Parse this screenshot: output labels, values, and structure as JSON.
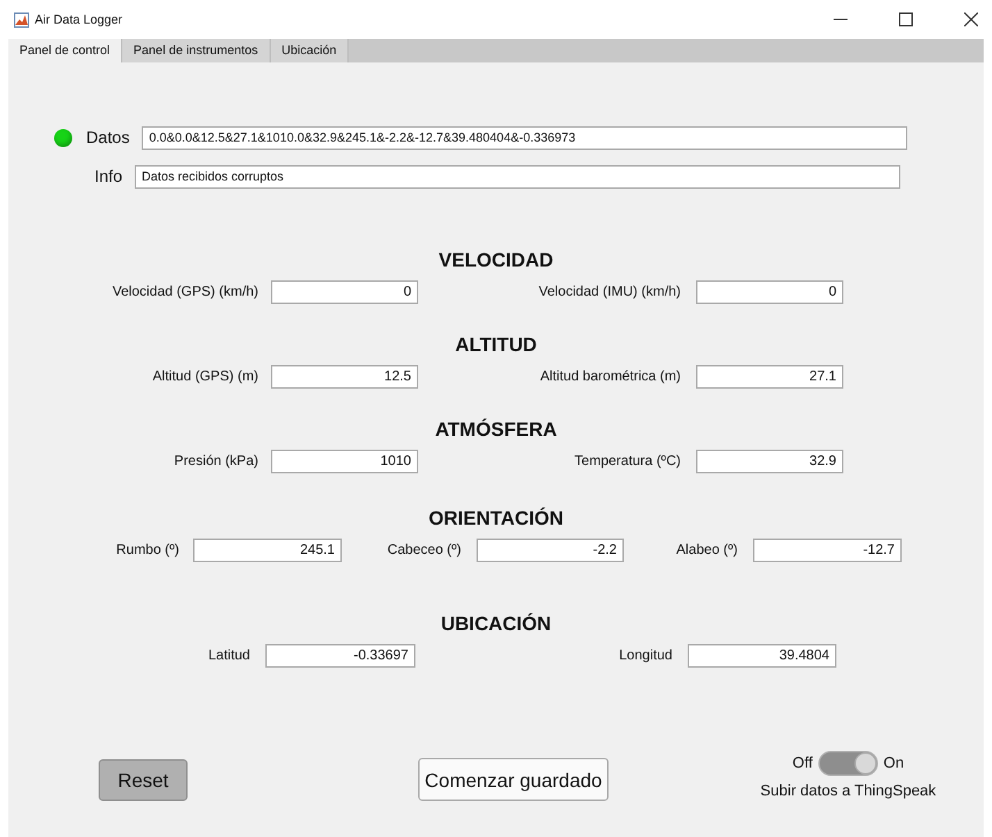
{
  "window": {
    "title": "Air Data Logger"
  },
  "tabs": [
    {
      "label": "Panel de control",
      "selected": true
    },
    {
      "label": "Panel de instrumentos",
      "selected": false
    },
    {
      "label": "Ubicación",
      "selected": false
    }
  ],
  "status": {
    "label": "Datos",
    "value": "0.0&0.0&12.5&27.1&1010.0&32.9&245.1&-2.2&-12.7&39.480404&-0.336973",
    "color": "#17d317"
  },
  "info": {
    "label": "Info",
    "value": "Datos recibidos corruptos"
  },
  "sections": [
    {
      "title": "VELOCIDAD",
      "kind": "two-column",
      "fields": [
        {
          "label": "Velocidad (GPS) (km/h)",
          "value": "0"
        },
        {
          "label": "Velocidad (IMU) (km/h)",
          "value": "0"
        }
      ]
    },
    {
      "title": "ALTITUD",
      "kind": "two-column",
      "fields": [
        {
          "label": "Altitud (GPS) (m)",
          "value": "12.5"
        },
        {
          "label": "Altitud barométrica (m)",
          "value": "27.1"
        }
      ]
    },
    {
      "title": "ATMÓSFERA",
      "kind": "two-column",
      "fields": [
        {
          "label": "Presión (kPa)",
          "value": "1010"
        },
        {
          "label": "Temperatura (ºC)",
          "value": "32.9"
        }
      ]
    },
    {
      "title": "ORIENTACIÓN",
      "kind": "three-column",
      "fields": [
        {
          "label": "Rumbo (º)",
          "value": "245.1"
        },
        {
          "label": "Cabeceo (º)",
          "value": "-2.2"
        },
        {
          "label": "Alabeo (º)",
          "value": "-12.7"
        }
      ]
    },
    {
      "title": "UBICACIÓN",
      "kind": "location",
      "fields": [
        {
          "label": "Latitud",
          "value": "-0.33697"
        },
        {
          "label": "Longitud",
          "value": "39.4804"
        }
      ]
    }
  ],
  "buttons": [
    {
      "label": "Reset",
      "kind": "pressed"
    },
    {
      "label": "Comenzar guardado",
      "kind": "normal"
    }
  ],
  "switch": {
    "off_label": "Off",
    "on_label": "On",
    "on": true,
    "caption": "Subir datos a ThingSpeak"
  }
}
